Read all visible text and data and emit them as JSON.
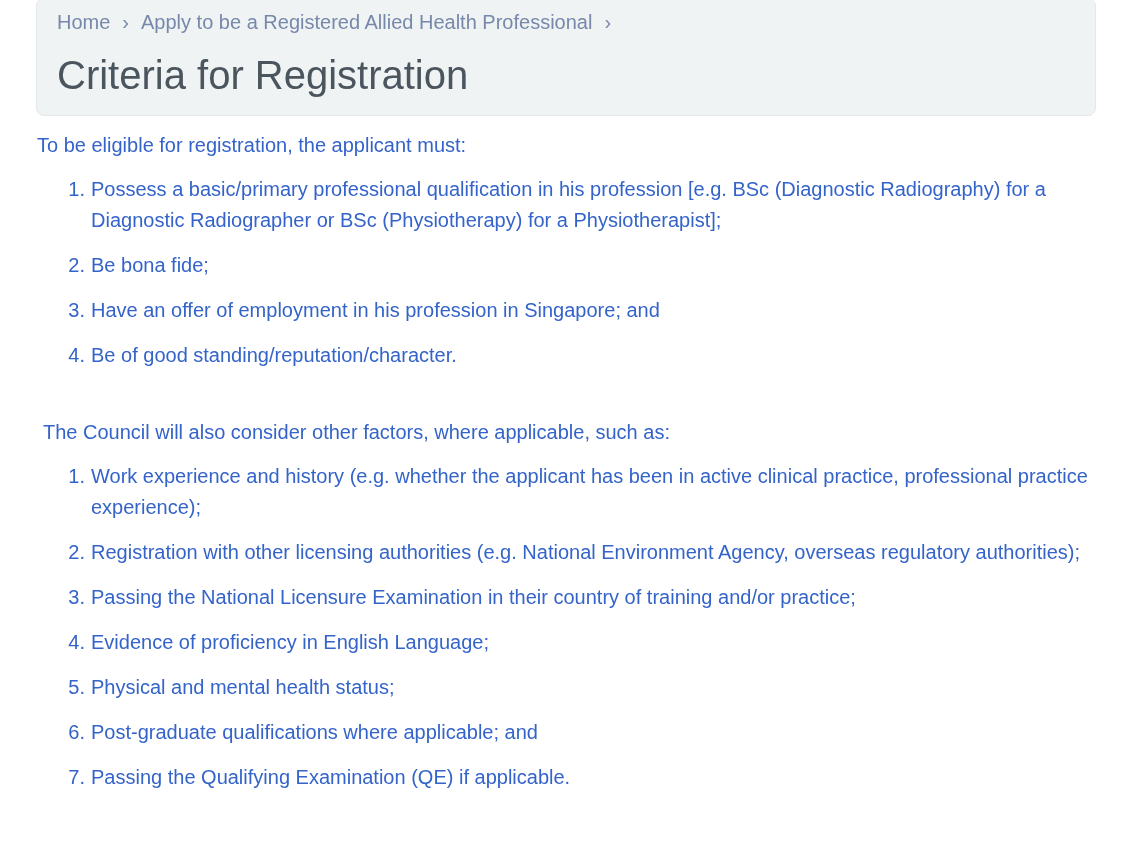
{
  "breadcrumb": [
    {
      "label": "Home"
    },
    {
      "label": "Apply to be a Registered Allied Health Professional"
    }
  ],
  "breadcrumb_separator": "›",
  "title": "Criteria for Registration",
  "sections": [
    {
      "intro": "To be eligible for registration, the applicant must:",
      "items": [
        {
          "number": "1.",
          "text": "Possess a basic/primary professional qualification in his profession [e.g. BSc (Diagnostic Radiography) for a Diagnostic Radiographer or BSc (Physiotherapy) for a Physiotherapist];"
        },
        {
          "number": "2.",
          "text": "Be bona fide;"
        },
        {
          "number": "3.",
          "text": "Have an offer of employment in his profession in Singapore; and"
        },
        {
          "number": "4.",
          "text": "Be of good standing/reputation/character."
        }
      ]
    },
    {
      "intro": "The Council will also consider other factors, where applicable, such as:",
      "items": [
        {
          "number": "1.",
          "text": "Work experience and history (e.g. whether the applicant has been in active clinical practice, professional practice experience);"
        },
        {
          "number": "2.",
          "text": "Registration with other licensing authorities (e.g. National Environment Agency, overseas regulatory authorities);"
        },
        {
          "number": "3.",
          "text": "Passing the National Licensure Examination in their country of training and/or practice;"
        },
        {
          "number": "4.",
          "text": "Evidence of proficiency in English Language;"
        },
        {
          "number": "5.",
          "text": "Physical and mental health status;"
        },
        {
          "number": "6.",
          "text": "Post-graduate qualifications where applicable; and"
        },
        {
          "number": "7.",
          "text": "Passing the Qualifying Examination (QE) if applicable."
        }
      ]
    }
  ]
}
